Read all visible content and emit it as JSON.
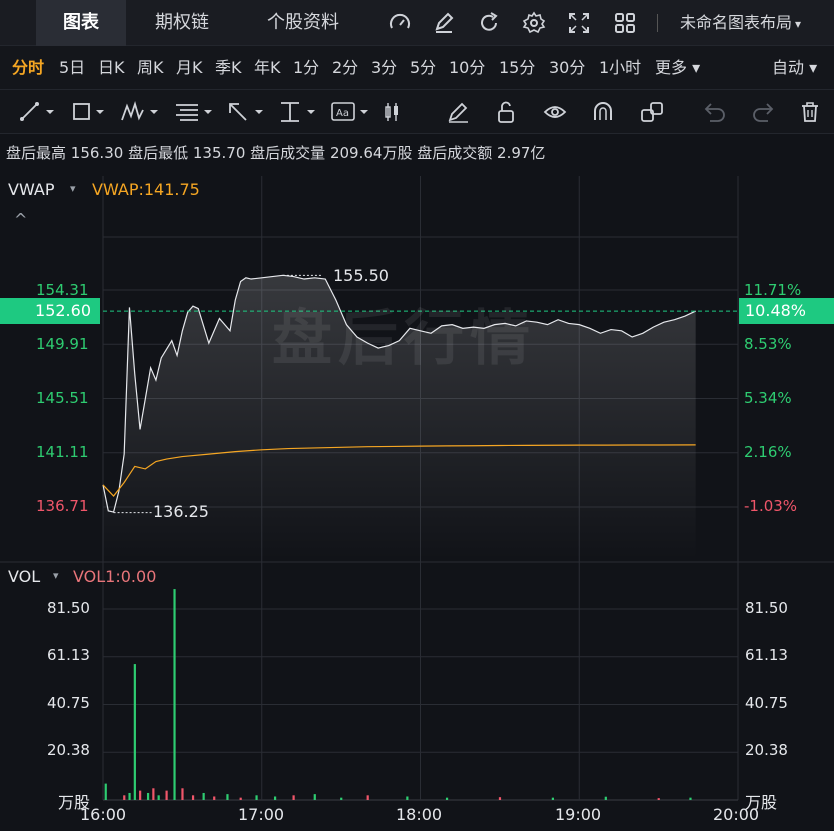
{
  "top_tabs": [
    {
      "label": "图表",
      "active": true
    },
    {
      "label": "期权链",
      "active": false
    },
    {
      "label": "个股资料",
      "active": false
    }
  ],
  "top_icons": [
    "gauge-icon",
    "edit-icon",
    "refresh-icon",
    "settings-icon",
    "fullscreen-icon",
    "grid-icon"
  ],
  "layout_name": "未命名图表布局",
  "layout_chevron": "▾",
  "periods": [
    {
      "label": "分时",
      "active": true
    },
    {
      "label": "5日"
    },
    {
      "label": "日K"
    },
    {
      "label": "周K"
    },
    {
      "label": "月K"
    },
    {
      "label": "季K"
    },
    {
      "label": "年K"
    },
    {
      "label": "1分"
    },
    {
      "label": "2分"
    },
    {
      "label": "3分"
    },
    {
      "label": "5分"
    },
    {
      "label": "10分"
    },
    {
      "label": "15分"
    },
    {
      "label": "30分"
    },
    {
      "label": "1小时"
    },
    {
      "label": "更多 ▾"
    }
  ],
  "auto_label": "自动 ▾",
  "info": {
    "high_label": "盘后最高",
    "high": "156.30",
    "low_label": "盘后最低",
    "low": "135.70",
    "vol_label": "盘后成交量",
    "vol": "209.64万股",
    "amt_label": "盘后成交额",
    "amt": "2.97亿"
  },
  "indicator": {
    "name": "VWAP",
    "value": "VWAP:141.75",
    "caret": "▾",
    "collapse": "^"
  },
  "volume_indicator": {
    "name": "VOL",
    "value": "VOL1:0.00",
    "caret": "▾"
  },
  "watermark": "盘后行情",
  "price_badge": "152.60",
  "pct_badge": "10.48%",
  "price_labels": [
    {
      "text": "154.31",
      "color": "green"
    },
    {
      "text": "149.91",
      "color": "green"
    },
    {
      "text": "145.51",
      "color": "green"
    },
    {
      "text": "141.11",
      "color": "green"
    },
    {
      "text": "136.71",
      "color": "pink"
    }
  ],
  "pct_labels": [
    {
      "text": "11.71%",
      "color": "green"
    },
    {
      "text": "8.53%",
      "color": "green"
    },
    {
      "text": "5.34%",
      "color": "green"
    },
    {
      "text": "2.16%",
      "color": "green"
    },
    {
      "text": "-1.03%",
      "color": "pink"
    }
  ],
  "high_marker": "155.50",
  "low_marker": "136.25",
  "vol_labels": [
    "81.50",
    "61.13",
    "40.75",
    "20.38"
  ],
  "vol_unit": "万股",
  "time_labels": [
    "16:00",
    "17:00",
    "18:00",
    "19:00",
    "20:00"
  ],
  "colors": {
    "green": "#2ecc71",
    "pink": "#f0566a",
    "vwap": "#f5a623",
    "accent": "#1ec981",
    "bg": "#111318"
  },
  "chart_data": {
    "type": "line",
    "x_range": [
      "16:00",
      "20:00"
    ],
    "price_ylim": [
      136.71,
      154.31
    ],
    "series": [
      {
        "name": "",
        "x": [
          0,
          2,
          4,
          6,
          8,
          10,
          12,
          14,
          16,
          18,
          20,
          22,
          24,
          26,
          28,
          30,
          32,
          34,
          36,
          40,
          44,
          48,
          50,
          52,
          54,
          56,
          60,
          64,
          68,
          72,
          76,
          80,
          84,
          88,
          90,
          92,
          96,
          100,
          104,
          108,
          112,
          116,
          120,
          124,
          128,
          132,
          136,
          140,
          144,
          148,
          152,
          156,
          160,
          164,
          168,
          172,
          176,
          180,
          184,
          188,
          192,
          196,
          200,
          204,
          208,
          212,
          216,
          220,
          224
        ],
        "values": [
          138.5,
          136.4,
          136.3,
          138.0,
          141.0,
          152.9,
          147.5,
          143.0,
          145.5,
          148.0,
          147.0,
          148.8,
          149.5,
          150.2,
          149.0,
          151.0,
          152.5,
          153.0,
          152.8,
          150.0,
          152.0,
          151.0,
          153.5,
          155.0,
          155.3,
          155.2,
          155.3,
          155.4,
          155.5,
          155.4,
          155.2,
          155.3,
          155.2,
          153.5,
          152.5,
          151.5,
          150.5,
          150.0,
          149.6,
          149.8,
          150.2,
          151.2,
          151.0,
          150.8,
          151.4,
          151.5,
          151.2,
          151.3,
          151.2,
          151.5,
          151.6,
          151.4,
          151.8,
          151.7,
          151.5,
          151.9,
          151.6,
          151.5,
          151.2,
          150.8,
          151.1,
          151.0,
          150.5,
          150.8,
          151.3,
          151.7,
          151.9,
          152.2,
          152.6
        ]
      },
      {
        "name": "VWAP",
        "x": [
          0,
          4,
          8,
          12,
          16,
          20,
          24,
          30,
          40,
          50,
          60,
          70,
          80,
          90,
          100,
          110,
          120,
          130,
          140,
          150,
          160,
          170,
          180,
          190,
          200,
          210,
          224
        ],
        "values": [
          138.5,
          137.6,
          138.7,
          140.0,
          139.8,
          140.4,
          140.6,
          140.8,
          141.0,
          141.2,
          141.35,
          141.45,
          141.5,
          141.55,
          141.6,
          141.62,
          141.65,
          141.67,
          141.68,
          141.7,
          141.71,
          141.72,
          141.73,
          141.73,
          141.74,
          141.74,
          141.75
        ]
      }
    ],
    "volume": {
      "ylim": [
        0,
        90
      ],
      "x": [
        1,
        8,
        10,
        12,
        14,
        17,
        19,
        21,
        24,
        27,
        30,
        34,
        38,
        42,
        47,
        52,
        58,
        65,
        72,
        80,
        90,
        100,
        115,
        130,
        150,
        170,
        190,
        210,
        222
      ],
      "values": [
        7,
        2,
        3,
        58,
        4,
        3,
        5,
        2,
        4,
        90,
        5,
        2,
        3,
        1.5,
        2.5,
        1,
        2,
        1.5,
        2,
        2.5,
        1,
        2,
        1.5,
        1,
        1.2,
        1,
        1.4,
        0.8,
        1
      ],
      "colors": [
        "green",
        "pink",
        "green",
        "green",
        "pink",
        "green",
        "pink",
        "green",
        "pink",
        "green",
        "pink",
        "pink",
        "green",
        "pink",
        "green",
        "pink",
        "green",
        "green",
        "pink",
        "green",
        "green",
        "pink",
        "green",
        "green",
        "pink",
        "green",
        "green",
        "pink",
        "green"
      ]
    }
  }
}
